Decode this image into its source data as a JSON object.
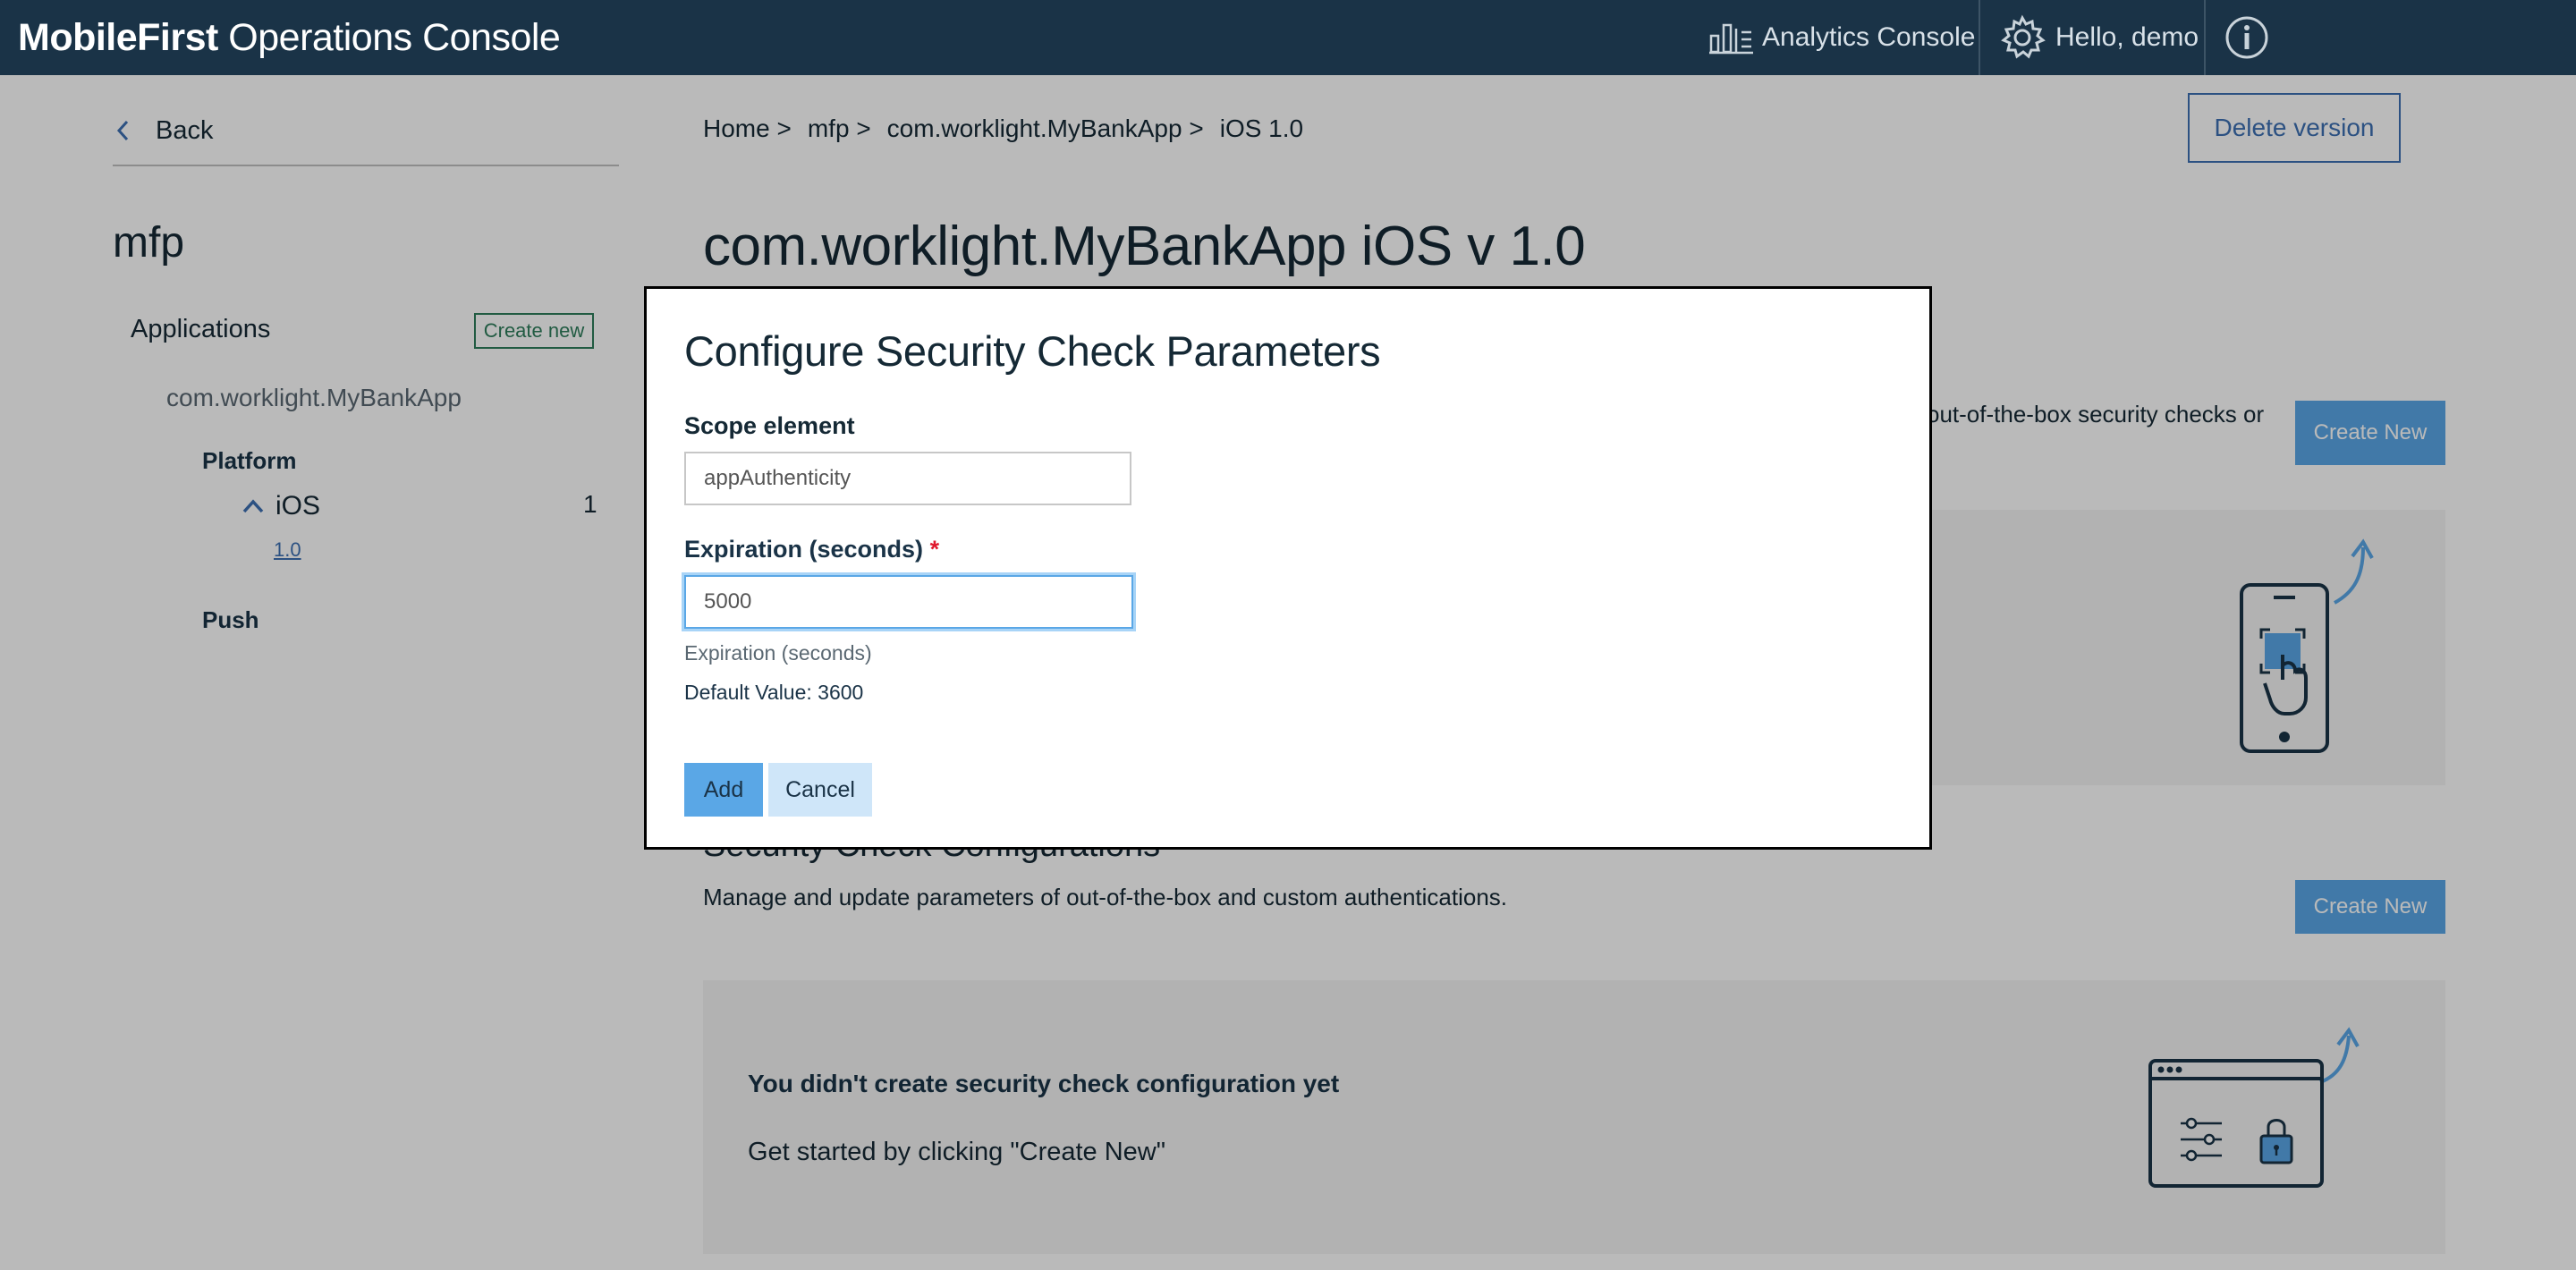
{
  "header": {
    "brand_bold": "MobileFirst",
    "brand_rest": " Operations Console",
    "analytics_label": "Analytics Console",
    "user_label": "Hello, demo"
  },
  "sidebar": {
    "back_label": "Back",
    "project_title": "mfp",
    "applications_label": "Applications",
    "create_new_label": "Create new",
    "app_name": "com.worklight.MyBankApp",
    "platform_label": "Platform",
    "ios_label": "iOS",
    "ios_count": "1",
    "version_link": "1.0",
    "push_label": "Push"
  },
  "main": {
    "breadcrumb": [
      {
        "label": "Home",
        "sep": ">"
      },
      {
        "label": "mfp",
        "sep": ">"
      },
      {
        "label": "com.worklight.MyBankApp",
        "sep": ">"
      },
      {
        "label": "iOS 1.0",
        "sep": ""
      }
    ],
    "delete_version_label": "Delete version",
    "page_title": "com.worklight.MyBankApp iOS v 1.0",
    "scope_desc_partial": "out-of-the-box security checks or",
    "create_new_label_1": "Create New",
    "security_section_title": "Security Check Configurations",
    "security_section_desc": "Manage and update parameters of out-of-the-box and custom authentications.",
    "create_new_label_2": "Create New",
    "empty_title": "You didn't create security check configuration yet",
    "empty_hint": "Get started by clicking \"Create New\""
  },
  "modal": {
    "title": "Configure Security Check Parameters",
    "scope_label": "Scope element",
    "scope_value": "appAuthenticity",
    "expiration_label": "Expiration (seconds)",
    "required_mark": "*",
    "expiration_value": "5000",
    "helper_text": "Expiration (seconds)",
    "default_value_text": "Default Value: 3600",
    "add_label": "Add",
    "cancel_label": "Cancel"
  },
  "colors": {
    "header_bg": "#1a3347",
    "accent_blue": "#3d70b2",
    "button_blue": "#5aa7e6",
    "create_new_green": "#2e7d5b",
    "required_red": "#e0182d"
  }
}
